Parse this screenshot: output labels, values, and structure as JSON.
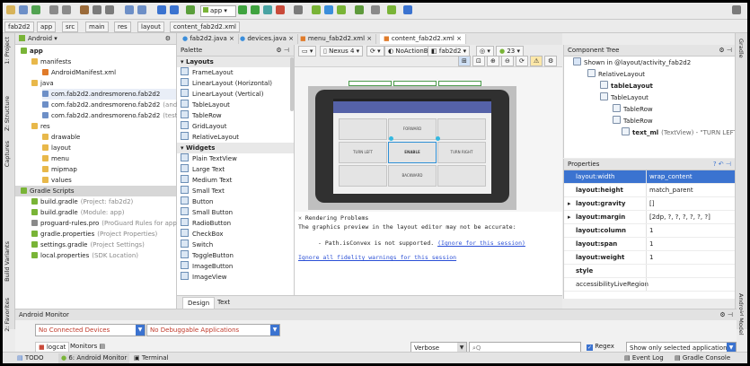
{
  "toolbar": {
    "run_config": "app"
  },
  "breadcrumbs": [
    "fab2d2",
    "app",
    "src",
    "main",
    "res",
    "layout",
    "content_fab2d2.xml"
  ],
  "left_tool_windows": [
    "1: Project",
    "Z: Structure",
    "Captures",
    "Build Variants",
    "2: Favorites"
  ],
  "right_tool_windows": [
    "Gradle",
    "Android Model"
  ],
  "project": {
    "view_mode": "Android",
    "tree": [
      {
        "label": "app",
        "bold": true
      },
      {
        "label": "manifests"
      },
      {
        "label": "AndroidManifest.xml"
      },
      {
        "label": "java"
      },
      {
        "label": "com.fab2d2.andresmoreno.fab2d2"
      },
      {
        "label": "com.fab2d2.andresmoreno.fab2d2",
        "suffix": "(andr"
      },
      {
        "label": "com.fab2d2.andresmoreno.fab2d2",
        "suffix": "(test)"
      },
      {
        "label": "res"
      },
      {
        "label": "drawable"
      },
      {
        "label": "layout"
      },
      {
        "label": "menu"
      },
      {
        "label": "mipmap"
      },
      {
        "label": "values"
      },
      {
        "label": "Gradle Scripts"
      },
      {
        "label": "build.gradle",
        "suffix": "(Project: fab2d2)"
      },
      {
        "label": "build.gradle",
        "suffix": "(Module: app)"
      },
      {
        "label": "proguard-rules.pro",
        "suffix": "(ProGuard Rules for app)"
      },
      {
        "label": "gradle.properties",
        "suffix": "(Project Properties)"
      },
      {
        "label": "settings.gradle",
        "suffix": "(Project Settings)"
      },
      {
        "label": "local.properties",
        "suffix": "(SDK Location)"
      }
    ]
  },
  "editor_tabs": [
    "fab2d2.java",
    "devices.java",
    "menu_fab2d2.xml",
    "content_fab2d2.xml"
  ],
  "palette": {
    "title": "Palette",
    "items": [
      {
        "label": "Layouts",
        "group": true
      },
      {
        "label": "FrameLayout"
      },
      {
        "label": "LinearLayout (Horizontal)"
      },
      {
        "label": "LinearLayout (Vertical)"
      },
      {
        "label": "TableLayout"
      },
      {
        "label": "TableRow"
      },
      {
        "label": "GridLayout"
      },
      {
        "label": "RelativeLayout"
      },
      {
        "label": "Widgets",
        "group": true
      },
      {
        "label": "Plain TextView"
      },
      {
        "label": "Large Text"
      },
      {
        "label": "Medium Text"
      },
      {
        "label": "Small Text"
      },
      {
        "label": "Button"
      },
      {
        "label": "Small Button"
      },
      {
        "label": "RadioButton"
      },
      {
        "label": "CheckBox"
      },
      {
        "label": "Switch"
      },
      {
        "label": "ToggleButton"
      },
      {
        "label": "ImageButton"
      },
      {
        "label": "ImageView"
      }
    ]
  },
  "design_toolbar": {
    "device": "Nexus 4",
    "theme": "NoActionBar",
    "activity": "fab2d2",
    "api": "23"
  },
  "preview": {
    "buttons": [
      "FORWARD",
      "TURN LEFT",
      "ENABLE",
      "TURN RIGHT",
      "BACKWARD"
    ]
  },
  "rendering": {
    "title": "Rendering Problems",
    "line1": "The graphics preview in the layout editor may not be accurate:",
    "line2": "- Path.isConvex is not supported.",
    "ignore_link": "(Ignore for this session)",
    "ignore_all_link": "Ignore all fidelity warnings for this session"
  },
  "design_tabs": [
    "Design",
    "Text"
  ],
  "component_tree": {
    "title": "Component Tree",
    "rows": [
      {
        "label": "Shown in @layout/activity_fab2d2"
      },
      {
        "label": "RelativeLayout"
      },
      {
        "label": "tableLayout",
        "bold": true
      },
      {
        "label": "TableLayout"
      },
      {
        "label": "TableRow"
      },
      {
        "label": "TableRow"
      },
      {
        "label": "text_ml",
        "bold": true,
        "suffix": "(TextView) - \"TURN LEFT\""
      }
    ]
  },
  "properties": {
    "title": "Properties",
    "rows": [
      {
        "name": "layout:width",
        "value": "wrap_content",
        "selected": true
      },
      {
        "name": "layout:height",
        "value": "match_parent"
      },
      {
        "name": "layout:gravity",
        "value": "[]"
      },
      {
        "name": "layout:margin",
        "value": "[2dp, ?, ?, ?, ?, ?, ?]"
      },
      {
        "name": "layout:column",
        "value": "1"
      },
      {
        "name": "layout:span",
        "value": "1"
      },
      {
        "name": "layout:weight",
        "value": "1"
      },
      {
        "name": "style",
        "value": ""
      },
      {
        "name": "accessibilityLiveRegion",
        "value": ""
      }
    ]
  },
  "monitor": {
    "title": "Android Monitor",
    "device_combo": "No Connected Devices",
    "app_combo": "No Debuggable Applications",
    "tabs": [
      "logcat",
      "Monitors"
    ],
    "level": "Verbose",
    "search_placeholder": "Q",
    "regex_label": "Regex",
    "filter": "Show only selected application"
  },
  "status_bar": {
    "todo": "TODO",
    "android_monitor": "6: Android Monitor",
    "terminal": "Terminal",
    "event_log": "Event Log",
    "gradle_console": "Gradle Console"
  },
  "colors": {
    "accent": "#3b73d0",
    "selection": "#c9dcf5",
    "link": "#2a4fd6",
    "green": "#3fa33f",
    "folder": "#e8b84a"
  }
}
